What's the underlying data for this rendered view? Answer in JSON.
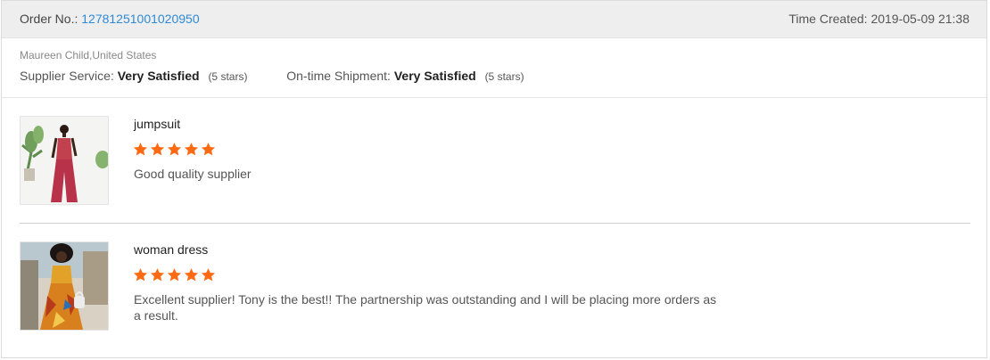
{
  "header": {
    "order_label": "Order No.:",
    "order_number": "12781251001020950",
    "time_label": "Time Created:",
    "time_value": "2019-05-09 21:38"
  },
  "buyer": {
    "name_location": "Maureen Child,United States"
  },
  "ratings": {
    "supplier_service_label": "Supplier Service:",
    "supplier_service_value": "Very Satisfied",
    "supplier_service_stars": "(5 stars)",
    "shipment_label": "On-time Shipment:",
    "shipment_value": "Very Satisfied",
    "shipment_stars": "(5 stars)"
  },
  "reviews": [
    {
      "product": "jumpsuit",
      "stars": 5,
      "comment": "Good quality supplier"
    },
    {
      "product": "woman dress",
      "stars": 5,
      "comment": "Excellent supplier! Tony is the best!!  The partnership was outstanding and I will be placing more orders as a result."
    }
  ],
  "colors": {
    "link_blue": "#2f8ad6",
    "star_orange": "#ff6a13",
    "header_bg": "#eeeeee"
  },
  "icons": {
    "star": "star-icon"
  }
}
